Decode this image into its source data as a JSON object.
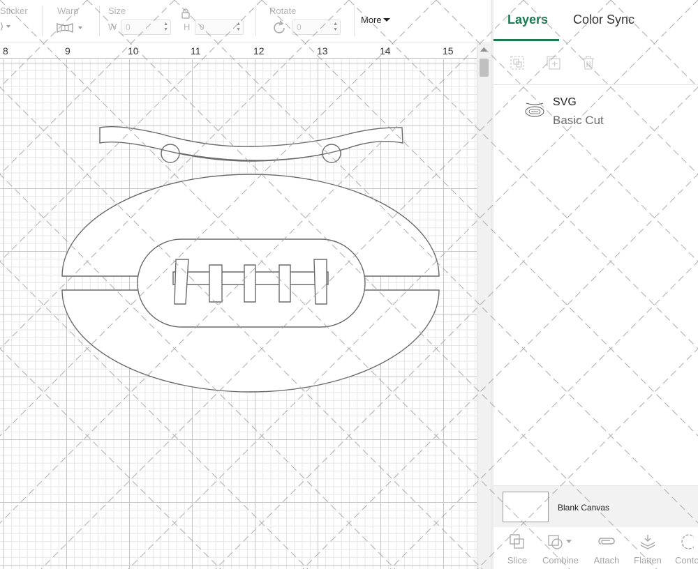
{
  "toolbar": {
    "sticker_label": "Sticker",
    "warp_label": "Warp",
    "size_label": "Size",
    "width_letter": "W",
    "width_value": "0",
    "height_letter": "H",
    "height_value": "0",
    "rotate_label": "Rotate",
    "rotate_value": "0",
    "more_label": "More"
  },
  "ruler": {
    "ticks": [
      "8",
      "9",
      "10",
      "11",
      "12",
      "13",
      "14",
      "15"
    ]
  },
  "panel": {
    "tabs": {
      "layers": "Layers",
      "color_sync": "Color Sync"
    },
    "layers": [
      {
        "name": "SVG",
        "operation": "Basic Cut"
      }
    ],
    "canvas_label": "Blank Canvas",
    "actions": [
      "Slice",
      "Combine",
      "Attach",
      "Flatten",
      "Conto"
    ]
  },
  "colors": {
    "accent": "#1b7a50",
    "grid_major": "#c4c4c4",
    "grid_minor": "#e6e6e6",
    "cut_outline": "#6a6a6a"
  },
  "icons": {
    "warp": "warp-icon",
    "lock": "lock-icon",
    "rotate": "rotate-icon",
    "group": "group-icon",
    "duplicate": "duplicate-icon",
    "delete": "trash-icon",
    "slice": "slice-icon",
    "combine": "combine-icon",
    "attach": "attach-icon",
    "flatten": "flatten-icon",
    "contour": "contour-icon"
  }
}
